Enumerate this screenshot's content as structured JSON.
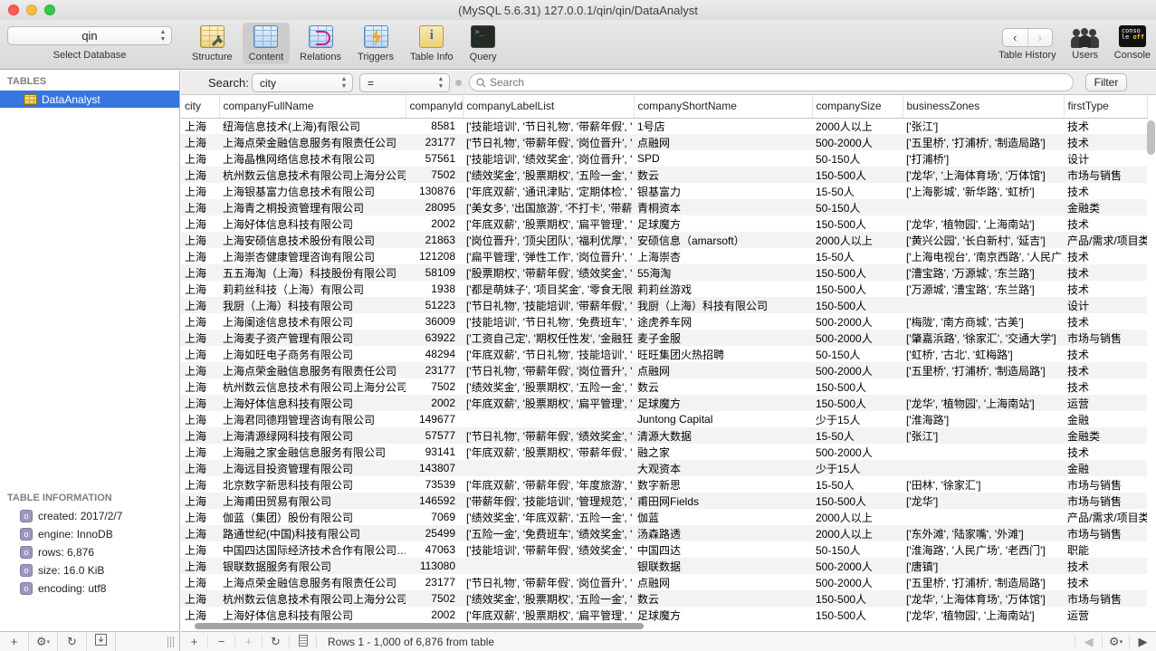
{
  "window": {
    "title": "(MySQL 5.6.31) 127.0.0.1/qin/qin/DataAnalyst"
  },
  "toolbar": {
    "select_database": {
      "value": "qin",
      "label": "Select Database"
    },
    "tabs": [
      {
        "id": "structure",
        "label": "Structure",
        "active": false
      },
      {
        "id": "content",
        "label": "Content",
        "active": true
      },
      {
        "id": "relations",
        "label": "Relations",
        "active": false
      },
      {
        "id": "triggers",
        "label": "Triggers",
        "active": false
      },
      {
        "id": "tableinfo",
        "label": "Table Info",
        "active": false
      },
      {
        "id": "query",
        "label": "Query",
        "active": false
      }
    ],
    "right": {
      "table_history_label": "Table History",
      "back_glyph": "‹",
      "forward_glyph": "›",
      "users_label": "Users",
      "console_label": "Console",
      "console_line1": "conso",
      "console_line2": "le ",
      "console_off": "off"
    }
  },
  "sidebar": {
    "tables_header": "TABLES",
    "table_item": "DataAnalyst",
    "info_header": "TABLE INFORMATION",
    "info_items": [
      "created: 2017/2/7",
      "engine: InnoDB",
      "rows: 6,876",
      "size: 16.0 KiB",
      "encoding: utf8"
    ]
  },
  "filter_bar": {
    "search_label": "Search:",
    "field_value": "city",
    "operator_value": "=",
    "search_placeholder": "Search",
    "filter_button": "Filter"
  },
  "table": {
    "columns": [
      "city",
      "companyFullName",
      "companyId",
      "companyLabelList",
      "companyShortName",
      "companySize",
      "businessZones",
      "firstType"
    ],
    "rows": [
      [
        "上海",
        "纽海信息技术(上海)有限公司",
        "8581",
        "['技能培训', '节日礼物', '带薪年假', '…",
        "1号店",
        "2000人以上",
        "['张江']",
        "技术"
      ],
      [
        "上海",
        "上海点荣金融信息服务有限责任公司",
        "23177",
        "['节日礼物', '带薪年假', '岗位晋升', '…",
        "点融网",
        "500-2000人",
        "['五里桥', '打浦桥', '制造局路']",
        "技术"
      ],
      [
        "上海",
        "上海晶樵网络信息技术有限公司",
        "57561",
        "['技能培训', '绩效奖金', '岗位晋升', '…",
        "SPD",
        "50-150人",
        "['打浦桥']",
        "设计"
      ],
      [
        "上海",
        "杭州数云信息技术有限公司上海分公司",
        "7502",
        "['绩效奖金', '股票期权', '五险一金', '…",
        "数云",
        "150-500人",
        "['龙华', '上海体育场', '万体馆']",
        "市场与销售"
      ],
      [
        "上海",
        "上海银基富力信息技术有限公司",
        "130876",
        "['年底双薪', '通讯津贴', '定期体检', '…",
        "银基富力",
        "15-50人",
        "['上海影城', '新华路', '虹桥']",
        "技术"
      ],
      [
        "上海",
        "上海青之桐投资管理有限公司",
        "28095",
        "['美女多', '出国旅游', '不打卡', '带薪…",
        "青桐资本",
        "50-150人",
        "",
        "金融类"
      ],
      [
        "上海",
        "上海好体信息科技有限公司",
        "2002",
        "['年底双薪', '股票期权', '扁平管理', '…",
        "足球魔方",
        "150-500人",
        "['龙华', '植物园', '上海南站']",
        "技术"
      ],
      [
        "上海",
        "上海安硕信息技术股份有限公司",
        "21863",
        "['岗位晋升', '顶尖团队', '福利优厚', '…",
        "安硕信息（amarsoft）",
        "2000人以上",
        "['黄兴公园', '长白新村', '延吉']",
        "产品/需求/项目类"
      ],
      [
        "上海",
        "上海崇杏健康管理咨询有限公司",
        "121208",
        "['扁平管理', '弹性工作', '岗位晋升', '…",
        "上海崇杏",
        "15-50人",
        "['上海电视台', '南京西路', '人民广…",
        "技术"
      ],
      [
        "上海",
        "五五海淘（上海）科技股份有限公司",
        "58109",
        "['股票期权', '带薪年假', '绩效奖金', '…",
        "55海淘",
        "150-500人",
        "['漕宝路', '万源城', '东兰路']",
        "技术"
      ],
      [
        "上海",
        "莉莉丝科技（上海）有限公司",
        "1938",
        "['都是萌妹子', '项目奖金', '零食无限量…",
        "莉莉丝游戏",
        "150-500人",
        "['万源城', '漕宝路', '东兰路']",
        "技术"
      ],
      [
        "上海",
        "我厨（上海）科技有限公司",
        "51223",
        "['节日礼物', '技能培训', '带薪年假', '…",
        "我厨（上海）科技有限公司",
        "150-500人",
        "",
        "设计"
      ],
      [
        "上海",
        "上海阑途信息技术有限公司",
        "36009",
        "['技能培训', '节日礼物', '免费班车', '…",
        "途虎养车网",
        "500-2000人",
        "['梅陇', '南方商城', '古美']",
        "技术"
      ],
      [
        "上海",
        "上海麦子资产管理有限公司",
        "63922",
        "['工资自己定', '期权任性发', '金融狂人…",
        "麦子金服",
        "500-2000人",
        "['肇嘉浜路', '徐家汇', '交通大学']",
        "市场与销售"
      ],
      [
        "上海",
        "上海如旺电子商务有限公司",
        "48294",
        "['年底双薪', '节日礼物', '技能培训', '…",
        "旺旺集团火热招聘",
        "50-150人",
        "['虹桥', '古北', '虹梅路']",
        "技术"
      ],
      [
        "上海",
        "上海点荣金融信息服务有限责任公司",
        "23177",
        "['节日礼物', '带薪年假', '岗位晋升', '…",
        "点融网",
        "500-2000人",
        "['五里桥', '打浦桥', '制造局路']",
        "技术"
      ],
      [
        "上海",
        "杭州数云信息技术有限公司上海分公司",
        "7502",
        "['绩效奖金', '股票期权', '五险一金', '…",
        "数云",
        "150-500人",
        "",
        "技术"
      ],
      [
        "上海",
        "上海好体信息科技有限公司",
        "2002",
        "['年底双薪', '股票期权', '扁平管理', '…",
        "足球魔方",
        "150-500人",
        "['龙华', '植物园', '上海南站']",
        "运营"
      ],
      [
        "上海",
        "上海君同德翔管理咨询有限公司",
        "149677",
        "",
        "Juntong Capital",
        "少于15人",
        "['淮海路']",
        "金融"
      ],
      [
        "上海",
        "上海清源绿网科技有限公司",
        "57577",
        "['节日礼物', '带薪年假', '绩效奖金', '…",
        "清源大数据",
        "15-50人",
        "['张江']",
        "金融类"
      ],
      [
        "上海",
        "上海融之家金融信息服务有限公司",
        "93141",
        "['年底双薪', '股票期权', '带薪年假', '…",
        "融之家",
        "500-2000人",
        "",
        "技术"
      ],
      [
        "上海",
        "上海远目投资管理有限公司",
        "143807",
        "",
        "大观资本",
        "少于15人",
        "",
        "金融"
      ],
      [
        "上海",
        "北京数字新思科技有限公司",
        "73539",
        "['年底双薪', '带薪年假', '年度旅游', '…",
        "数字新思",
        "15-50人",
        "['田林', '徐家汇']",
        "市场与销售"
      ],
      [
        "上海",
        "上海甫田贸易有限公司",
        "146592",
        "['带薪年假', '技能培训', '管理规范', '…",
        "甫田网Fields",
        "150-500人",
        "['龙华']",
        "市场与销售"
      ],
      [
        "上海",
        "伽蓝（集团）股份有限公司",
        "7069",
        "['绩效奖金', '年底双薪', '五险一金', '…",
        "伽蓝",
        "2000人以上",
        "",
        "产品/需求/项目类"
      ],
      [
        "上海",
        "路通世纪(中国)科技有限公司",
        "25499",
        "['五险一金', '免费班车', '绩效奖金', '…",
        "汤森路透",
        "2000人以上",
        "['东外滩', '陆家嘴', '外滩']",
        "市场与销售"
      ],
      [
        "上海",
        "中国四达国际经济技术合作有限公司…",
        "47063",
        "['技能培训', '带薪年假', '绩效奖金', '…",
        "中国四达",
        "50-150人",
        "['淮海路', '人民广场', '老西门']",
        "职能"
      ],
      [
        "上海",
        "银联数据服务有限公司",
        "113080",
        "",
        "银联数据",
        "500-2000人",
        "['唐镇']",
        "技术"
      ],
      [
        "上海",
        "上海点荣金融信息服务有限责任公司",
        "23177",
        "['节日礼物', '带薪年假', '岗位晋升', '…",
        "点融网",
        "500-2000人",
        "['五里桥', '打浦桥', '制造局路']",
        "技术"
      ],
      [
        "上海",
        "杭州数云信息技术有限公司上海分公司",
        "7502",
        "['绩效奖金', '股票期权', '五险一金', '…",
        "数云",
        "150-500人",
        "['龙华', '上海体育场', '万体馆']",
        "市场与销售"
      ],
      [
        "上海",
        "上海好体信息科技有限公司",
        "2002",
        "['年底双薪', '股票期权', '扁平管理', '…",
        "足球魔方",
        "150-500人",
        "['龙华', '植物园', '上海南站']",
        "运营"
      ]
    ]
  },
  "status_bar": {
    "text": "Rows 1 - 1,000 of 6,876 from table"
  },
  "colors": {
    "selection_blue": "#3676df",
    "zebra_row": "#f3f3f5",
    "titlebar": "#e4e4e4"
  }
}
